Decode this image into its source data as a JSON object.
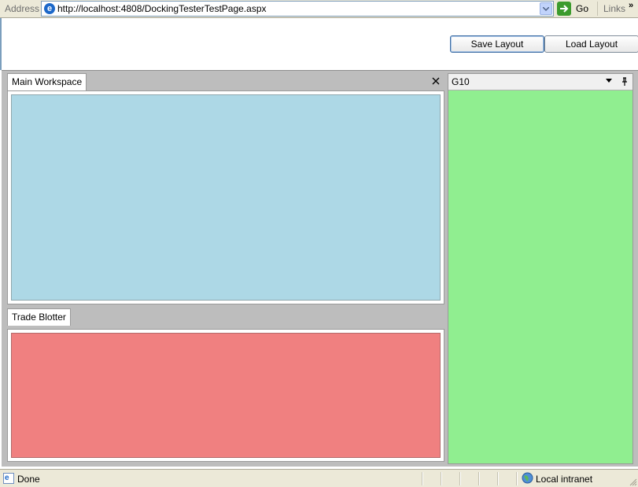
{
  "address_bar": {
    "label": "Address",
    "url": "http://localhost:4808/DockingTesterTestPage.aspx",
    "go_label": "Go",
    "links_label": "Links",
    "overflow_glyph": "»"
  },
  "toolbar": {
    "save_label": "Save Layout",
    "load_label": "Load Layout"
  },
  "workspace": {
    "main_tab": "Main Workspace",
    "main_color": "#add8e6",
    "trade_tab": "Trade Blotter",
    "trade_color": "#f08080"
  },
  "side_pane": {
    "title": "G10",
    "color": "#90ee90"
  },
  "status_bar": {
    "status": "Done",
    "zone": "Local intranet"
  }
}
